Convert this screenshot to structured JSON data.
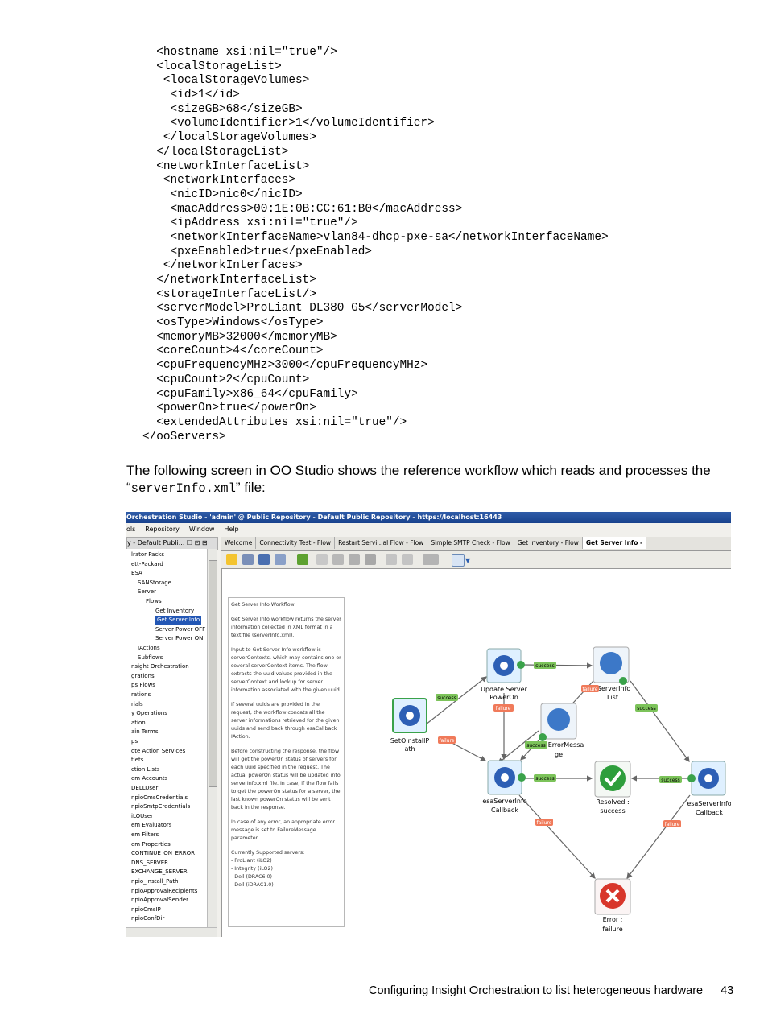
{
  "code_lines": [
    "  <hostname xsi:nil=\"true\"/>",
    "  <localStorageList>",
    "   <localStorageVolumes>",
    "    <id>1</id>",
    "    <sizeGB>68</sizeGB>",
    "    <volumeIdentifier>1</volumeIdentifier>",
    "   </localStorageVolumes>",
    "  </localStorageList>",
    "  <networkInterfaceList>",
    "   <networkInterfaces>",
    "    <nicID>nic0</nicID>",
    "    <macAddress>00:1E:0B:CC:61:B0</macAddress>",
    "    <ipAddress xsi:nil=\"true\"/>",
    "    <networkInterfaceName>vlan84-dhcp-pxe-sa</networkInterfaceName>",
    "    <pxeEnabled>true</pxeEnabled>",
    "   </networkInterfaces>",
    "  </networkInterfaceList>",
    "  <storageInterfaceList/>",
    "  <serverModel>ProLiant DL380 G5</serverModel>",
    "  <osType>Windows</osType>",
    "  <memoryMB>32000</memoryMB>",
    "  <coreCount>4</coreCount>",
    "  <cpuFrequencyMHz>3000</cpuFrequencyMHz>",
    "  <cpuCount>2</cpuCount>",
    "  <cpuFamily>x86_64</cpuFamily>",
    "  <powerOn>true</powerOn>",
    "  <extendedAttributes xsi:nil=\"true\"/>",
    "</ooServers>"
  ],
  "paragraph": {
    "text_before": "The following screen in OO Studio shows the reference workflow which reads and processes the “",
    "code": "serverInfo.xml",
    "text_after": "” file:"
  },
  "screenshot": {
    "window_title": "Orchestration Studio - 'admin' @ Public Repository - Default Public Repository - https://localhost:16443",
    "menu": [
      "ols",
      "Repository",
      "Window",
      "Help"
    ],
    "left_header": "y - Default Publi...  ☐  ⊡  ⊟",
    "tree": [
      "lrator Packs",
      "ett-Packard",
      "ESA",
      "SANStorage",
      "Server",
      "Flows",
      "Get Inventory",
      "Get Server Info",
      "Server Power OFF",
      "Server Power ON",
      "IActions",
      "Subflows",
      "nsight Orchestration",
      "grations",
      "ps Flows",
      "rations",
      "rials",
      "y Operations",
      "ation",
      "ain Terms",
      "ps",
      "ote Action Services",
      "tlets",
      "ction Lists",
      "em Accounts",
      "DELLUser",
      "npioCmsCredentials",
      "npioSmtpCredentials",
      "iLOUser",
      "em Evaluators",
      "em Filters",
      "em Properties",
      "CONTINUE_ON_ERROR",
      "DNS_SERVER",
      "EXCHANGE_SERVER",
      "npio_Install_Path",
      "npioApprovalRecipients",
      "npioApprovalSender",
      "npioCmsIP",
      "npioConfDir"
    ],
    "tabs": [
      "Welcome",
      "Connectivity Test - Flow",
      "Restart Servi...al Flow - Flow",
      "Simple SMTP Check - Flow",
      "Get Inventory - Flow",
      "Get Server Info -"
    ],
    "description": [
      "Get Server Info Workflow",
      "Get Server Info workflow returns the server information collected in XML format in a text file (serverInfo.xml).",
      "Input to Get Server Info workflow is serverContexts, which may contains one or several serverContext items. The flow extracts the uuid values provided in the serverContext and lookup for server information associated with the given uuid.",
      "If several uuids are provided in the request, the workflow concats all the server informations retrieved for the given uuids and send back through esaCallback IAction.",
      "Before constructing the response, the flow will get the powerOn status of servers for each uuid specified in the request. The actual powerOn status will be updated into serverInfo.xml file. In case, if the flow fails to get the powerOn status for a server, the last known powerOn status will be sent back in the response.",
      "In case of any error, an appropriate error message is set to FailureMessage parameter.",
      "Currently Supported servers:\n- ProLiant (iLO2)\n- Integrity (iLO2)\n- Dell (DRAC6.0)\n- Dell (iDRAC1.0)"
    ],
    "nodes": {
      "start": [
        "SetOInstallP",
        "ath"
      ],
      "update": [
        "Update Server",
        "PowerOn"
      ],
      "serverinfo": [
        "tServerInfo",
        "List"
      ],
      "errormsg": [
        "ErrorMessa",
        "ge"
      ],
      "callback_mid": [
        "esaServerInfo",
        "Callback"
      ],
      "resolved": [
        "Resolved :",
        "success"
      ],
      "callback_right": [
        "esaServerInfo",
        "Callback"
      ],
      "error": [
        "Error :",
        "failure"
      ]
    },
    "tags": {
      "success": "success",
      "failure": "failure"
    }
  },
  "footer": {
    "text": "Configuring Insight Orchestration to list heterogeneous hardware",
    "page": "43"
  }
}
